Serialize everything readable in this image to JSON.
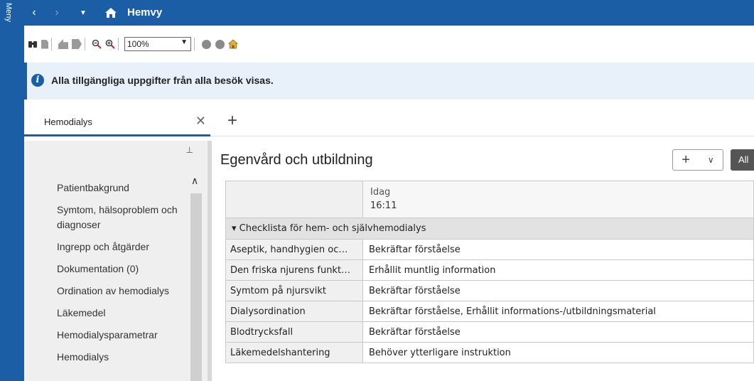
{
  "menu": {
    "label": "Meny"
  },
  "titlebar": {
    "title": "Hemvy",
    "back": "‹",
    "forward": "›",
    "dropdown": "▼",
    "home": "⌂"
  },
  "toolbar": {
    "zoom": "100%"
  },
  "banner": {
    "info_icon": "i",
    "text": "Alla tillgängliga uppgifter från alla besök visas."
  },
  "tabs": {
    "active_label": "Hemodialys",
    "close": "✕",
    "add": "+"
  },
  "sidebar": {
    "pin": "⊥",
    "items": [
      "Patientbakgrund",
      "Symtom, hälsoproblem och diagnoser",
      "Ingrepp och åtgärder",
      "Dokumentation (0)",
      "Ordination av hemodialys",
      "Läkemedel",
      "Hemodialysparametrar",
      "Hemodialys"
    ]
  },
  "main": {
    "title": "Egenvård och utbildning",
    "add_button": "+",
    "add_chevron": "∨",
    "all_button": "All",
    "table": {
      "col_day": "Idag",
      "col_time": "16:11",
      "group": "▾  Checklista för hem- och självhemodialys",
      "rows": [
        {
          "label": "Aseptik, handhygien oc…",
          "value": "Bekräftar förståelse"
        },
        {
          "label": "Den friska njurens funkt…",
          "value": "Erhållit muntlig information"
        },
        {
          "label": "Symtom på njursvikt",
          "value": "Bekräftar förståelse"
        },
        {
          "label": "Dialysordination",
          "value": "Bekräftar förståelse, Erhållit informations-/utbildningsmaterial"
        },
        {
          "label": "Blodtrycksfall",
          "value": "Bekräftar förståelse"
        },
        {
          "label": "Läkemedelshantering",
          "value": "Behöver ytterligare instruktion"
        }
      ]
    }
  },
  "colors": {
    "brand": "#1b5ea6",
    "banner_bg": "#e8f0fa",
    "sidebar_bg": "#efefef"
  },
  "icons": [
    "binoculars-icon",
    "document-icon",
    "arrow-left-icon",
    "arrow-right-icon",
    "zoom-out-icon",
    "zoom-in-icon",
    "circle-icon",
    "home-icon"
  ]
}
